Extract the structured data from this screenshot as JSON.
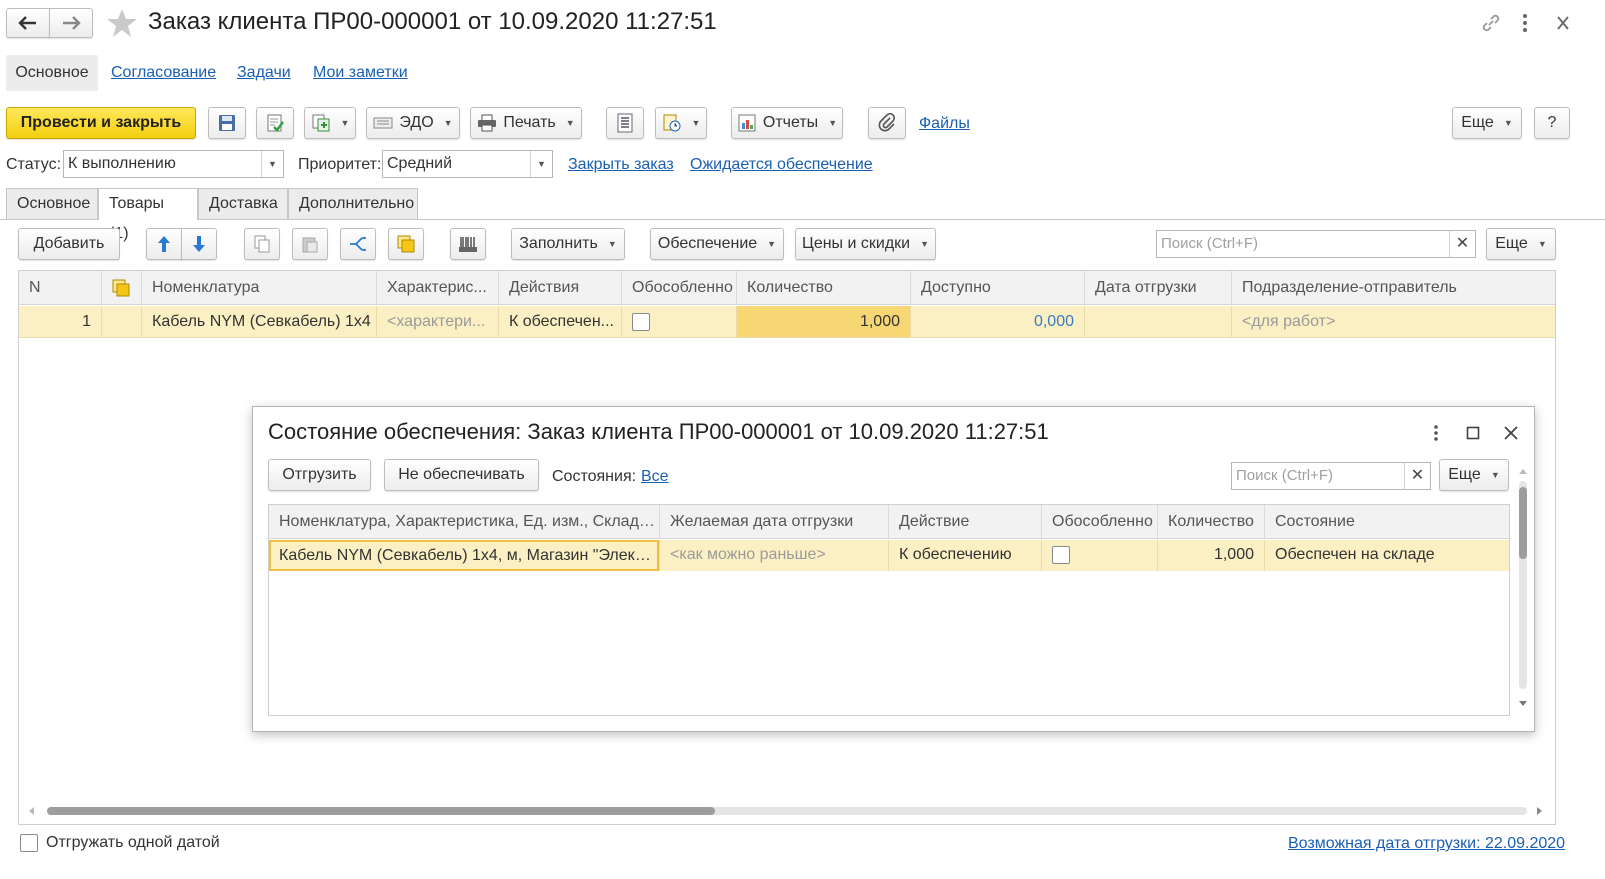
{
  "window": {
    "title": "Заказ клиента ПР00-000001 от 10.09.2020 11:27:51"
  },
  "nav_tabs": [
    "Основное",
    "Согласование",
    "Задачи",
    "Мои заметки"
  ],
  "toolbar": {
    "post_close": "Провести и закрыть",
    "edo": "ЭДО",
    "print": "Печать",
    "reports": "Отчеты",
    "files": "Файлы",
    "more": "Еще",
    "help": "?"
  },
  "status_row": {
    "status_label": "Статус:",
    "status_value": "К выполнению",
    "priority_label": "Приоритет:",
    "priority_value": "Средний",
    "close_order": "Закрыть заказ",
    "awaiting": "Ожидается обеспечение"
  },
  "tabs": [
    "Основное",
    "Товары (1)",
    "Доставка",
    "Дополнительно"
  ],
  "goods_toolbar": {
    "add": "Добавить",
    "fill": "Заполнить",
    "supply": "Обеспечение",
    "prices": "Цены и скидки",
    "search_placeholder": "Поиск (Ctrl+F)",
    "more": "Еще"
  },
  "goods_table": {
    "columns": [
      "N",
      "Номенклатура",
      "Характерис...",
      "Действия",
      "Обособленно",
      "Количество",
      "Доступно",
      "Дата отгрузки",
      "Подразделение-отправитель"
    ],
    "rows": [
      {
        "n": "1",
        "item": "Кабель NYM (Севкабель) 1х4",
        "characteristic": "<характери...",
        "action": "К обеспечен...",
        "qty": "1,000",
        "available": "0,000",
        "ship_date": "",
        "department": "<для работ>"
      }
    ]
  },
  "footer": {
    "ship_one_date": "Отгружать одной датой",
    "possible_date": "Возможная дата отгрузки: 22.09.2020"
  },
  "dialog": {
    "title": "Состояние обеспечения: Заказ клиента ПР00-000001 от 10.09.2020 11:27:51",
    "ship": "Отгрузить",
    "no_supply": "Не обеспечивать",
    "states_label": "Состояния:",
    "states_value": "Все",
    "search_placeholder": "Поиск (Ctrl+F)",
    "more": "Еще",
    "columns": [
      "Номенклатура, Характеристика, Ед. изм., Склад / ...",
      "Желаемая дата отгрузки",
      "Действие",
      "Обособленно",
      "Количество",
      "Состояние"
    ],
    "rows": [
      {
        "item": "Кабель NYM (Севкабель) 1х4, м, Магазин \"Электр...",
        "date": "<как можно раньше>",
        "action": "К обеспечению",
        "qty": "1,000",
        "state": "Обеспечен на складе"
      }
    ]
  },
  "colors": {
    "accent_yellow": "#f5d21a",
    "row_highlight": "#fbf0c4",
    "link": "#1a5fb4"
  }
}
